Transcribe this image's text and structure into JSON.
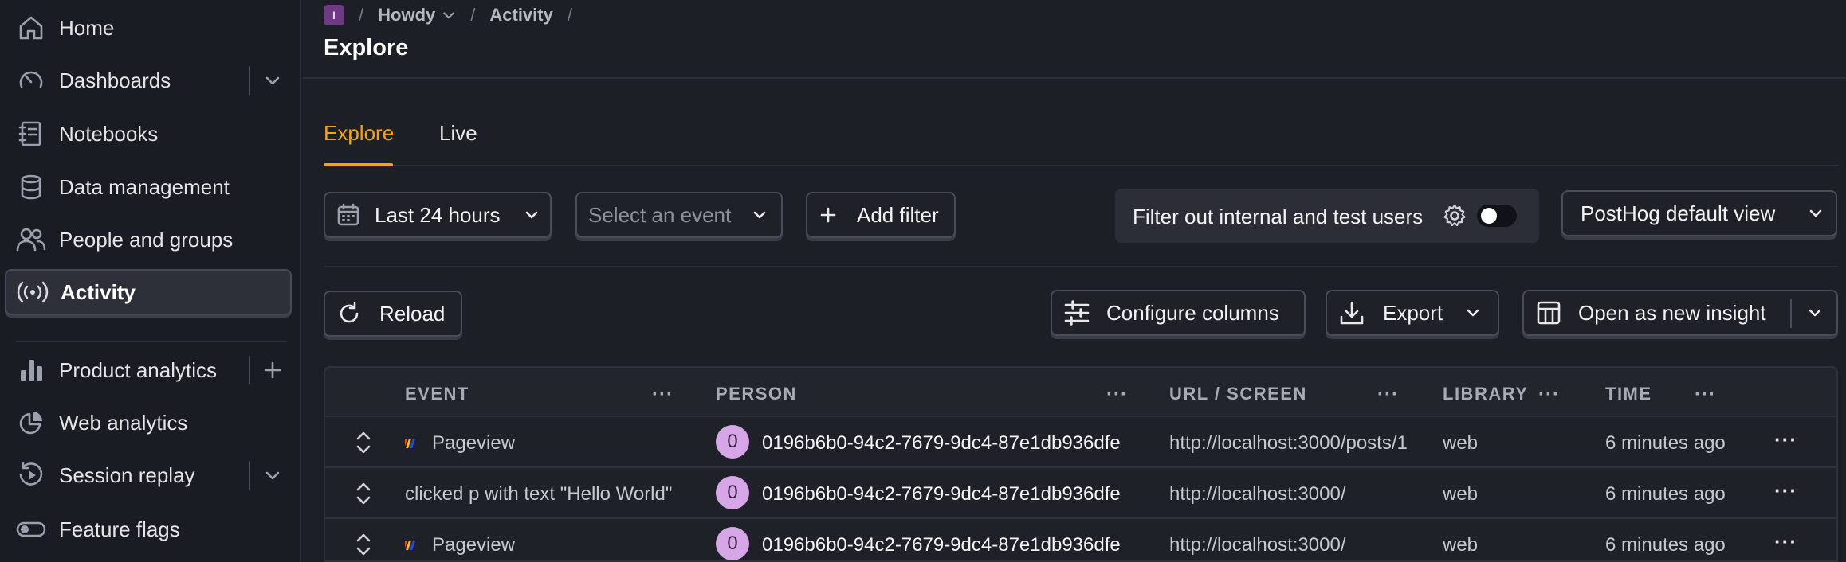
{
  "sidebar": {
    "items": [
      {
        "label": "Home",
        "icon": "home-icon"
      },
      {
        "label": "Dashboards",
        "icon": "dashboard-gauge-icon",
        "extra": "chevron-down-icon"
      },
      {
        "label": "Notebooks",
        "icon": "notebook-icon"
      },
      {
        "label": "Data management",
        "icon": "database-icon"
      },
      {
        "label": "People and groups",
        "icon": "people-icon"
      },
      {
        "label": "Activity",
        "icon": "activity-broadcast-icon",
        "active": true
      },
      {
        "label": "Product analytics",
        "icon": "bar-chart-icon",
        "extra": "plus-icon"
      },
      {
        "label": "Web analytics",
        "icon": "pie-chart-icon"
      },
      {
        "label": "Session replay",
        "icon": "replay-icon",
        "extra": "chevron-down-icon"
      },
      {
        "label": "Feature flags",
        "icon": "toggle-icon"
      }
    ]
  },
  "breadcrumb": {
    "project_initial": "I",
    "project": "Howdy",
    "section": "Activity",
    "sep": "/"
  },
  "page": {
    "title": "Explore"
  },
  "tabs": [
    {
      "label": "Explore",
      "active": true
    },
    {
      "label": "Live",
      "active": false
    }
  ],
  "filters": {
    "date_range": "Last 24 hours",
    "event_placeholder": "Select an event",
    "add_filter": "Add filter",
    "internal_users": "Filter out internal and test users",
    "internal_toggle_on": false,
    "view": "PostHog default view"
  },
  "toolbar": {
    "reload": "Reload",
    "configure_columns": "Configure columns",
    "export": "Export",
    "open_insight": "Open as new insight"
  },
  "table": {
    "columns": [
      {
        "label": "EVENT",
        "more": "···"
      },
      {
        "label": "PERSON",
        "more": "···"
      },
      {
        "label": "URL / SCREEN",
        "more": "···"
      },
      {
        "label": "LIBRARY",
        "more": "···"
      },
      {
        "label": "TIME",
        "more": "···"
      }
    ],
    "rows": [
      {
        "event": "Pageview",
        "pageview": true,
        "avatar": "0",
        "person": "0196b6b0-94c2-7679-9dc4-87e1db936dfe",
        "url": "http://localhost:3000/posts/1",
        "library": "web",
        "time": "6 minutes ago",
        "more": "···"
      },
      {
        "event": "clicked p with text \"Hello World\"",
        "pageview": false,
        "avatar": "0",
        "person": "0196b6b0-94c2-7679-9dc4-87e1db936dfe",
        "url": "http://localhost:3000/",
        "library": "web",
        "time": "6 minutes ago",
        "more": "···"
      },
      {
        "event": "Pageview",
        "pageview": true,
        "avatar": "0",
        "person": "0196b6b0-94c2-7679-9dc4-87e1db936dfe",
        "url": "http://localhost:3000/",
        "library": "web",
        "time": "6 minutes ago",
        "more": "···"
      }
    ]
  },
  "colors": {
    "accent": "#f7a501",
    "avatar": "#d6a6e6",
    "project_badge": "#6f3a84"
  }
}
